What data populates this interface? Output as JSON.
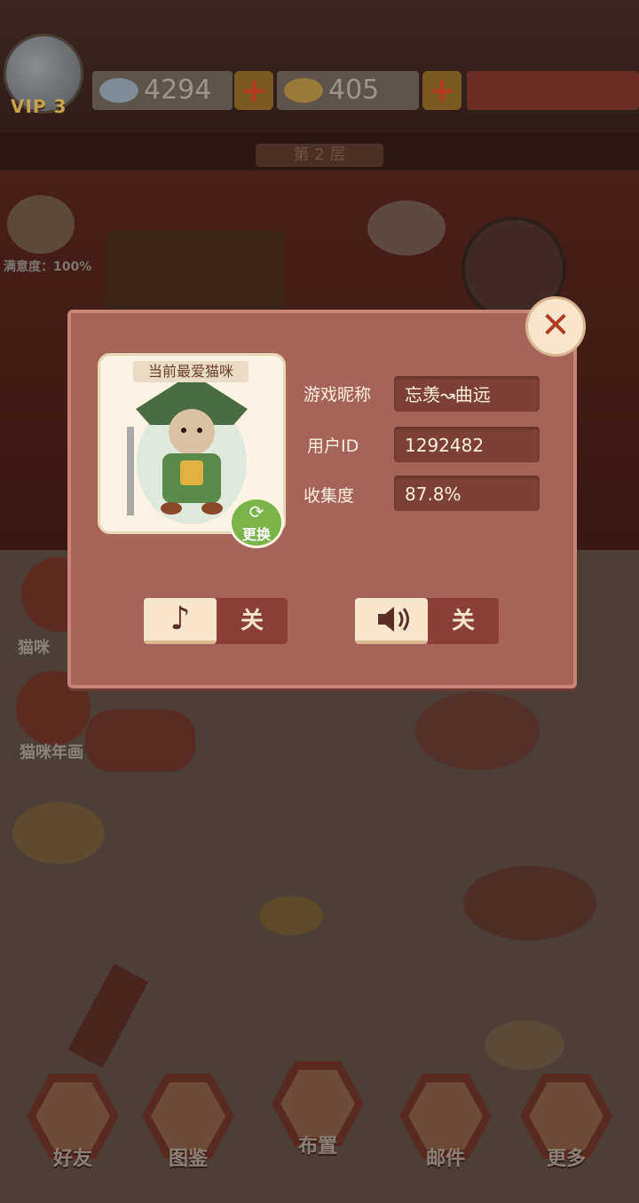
{
  "hud": {
    "vip_label": "VIP 3",
    "fish_count": "4294",
    "gold_fish_count": "405",
    "floor_label": "第 2 层",
    "satisfaction_label": "满意度：100%"
  },
  "side_menu": {
    "item1_label": "猫咪",
    "item2_label": "猫咪年画"
  },
  "nav": {
    "friends": "好友",
    "catalog": "图鉴",
    "decorate": "布置",
    "mail": "邮件",
    "more": "更多"
  },
  "profile": {
    "portrait_title": "当前最爱猫咪",
    "change_label": "更换",
    "nickname_label": "游戏昵称",
    "nickname_value": "忘羡↝曲远",
    "userid_label": "用户ID",
    "userid_value": "1292482",
    "collection_label": "收集度",
    "collection_value": "87.8%",
    "music_state": "关",
    "sound_state": "关"
  },
  "icons": {
    "close": "close-icon",
    "music": "music-note-icon",
    "sound": "speaker-icon",
    "refresh": "refresh-icon"
  },
  "colors": {
    "modal_bg": "#a6635a",
    "field_bg": "#7d4038",
    "accent_red": "#b23a1f",
    "green": "#7ab34a"
  }
}
